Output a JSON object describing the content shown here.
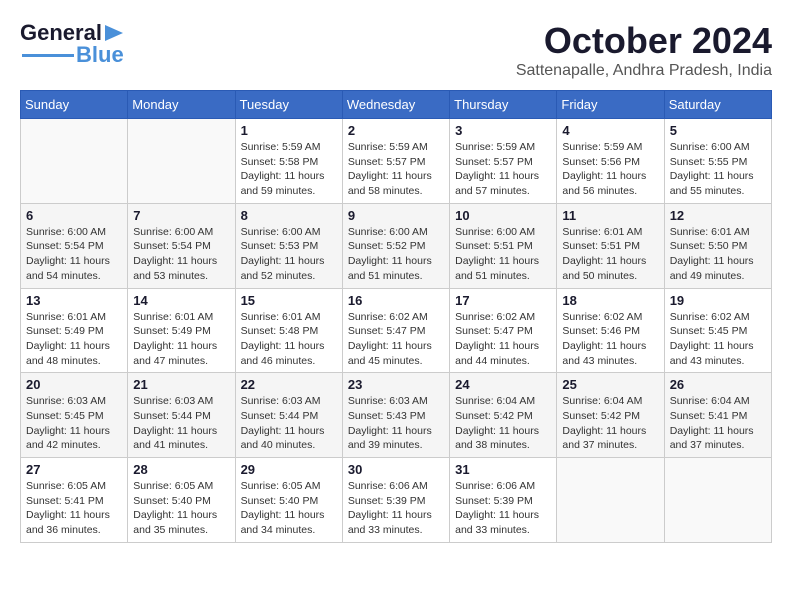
{
  "header": {
    "logo_general": "General",
    "logo_blue": "Blue",
    "month_title": "October 2024",
    "location": "Sattenapalle, Andhra Pradesh, India"
  },
  "calendar": {
    "headers": [
      "Sunday",
      "Monday",
      "Tuesday",
      "Wednesday",
      "Thursday",
      "Friday",
      "Saturday"
    ],
    "weeks": [
      [
        {
          "day": "",
          "info": ""
        },
        {
          "day": "",
          "info": ""
        },
        {
          "day": "1",
          "info": "Sunrise: 5:59 AM\nSunset: 5:58 PM\nDaylight: 11 hours and 59 minutes."
        },
        {
          "day": "2",
          "info": "Sunrise: 5:59 AM\nSunset: 5:57 PM\nDaylight: 11 hours and 58 minutes."
        },
        {
          "day": "3",
          "info": "Sunrise: 5:59 AM\nSunset: 5:57 PM\nDaylight: 11 hours and 57 minutes."
        },
        {
          "day": "4",
          "info": "Sunrise: 5:59 AM\nSunset: 5:56 PM\nDaylight: 11 hours and 56 minutes."
        },
        {
          "day": "5",
          "info": "Sunrise: 6:00 AM\nSunset: 5:55 PM\nDaylight: 11 hours and 55 minutes."
        }
      ],
      [
        {
          "day": "6",
          "info": "Sunrise: 6:00 AM\nSunset: 5:54 PM\nDaylight: 11 hours and 54 minutes."
        },
        {
          "day": "7",
          "info": "Sunrise: 6:00 AM\nSunset: 5:54 PM\nDaylight: 11 hours and 53 minutes."
        },
        {
          "day": "8",
          "info": "Sunrise: 6:00 AM\nSunset: 5:53 PM\nDaylight: 11 hours and 52 minutes."
        },
        {
          "day": "9",
          "info": "Sunrise: 6:00 AM\nSunset: 5:52 PM\nDaylight: 11 hours and 51 minutes."
        },
        {
          "day": "10",
          "info": "Sunrise: 6:00 AM\nSunset: 5:51 PM\nDaylight: 11 hours and 51 minutes."
        },
        {
          "day": "11",
          "info": "Sunrise: 6:01 AM\nSunset: 5:51 PM\nDaylight: 11 hours and 50 minutes."
        },
        {
          "day": "12",
          "info": "Sunrise: 6:01 AM\nSunset: 5:50 PM\nDaylight: 11 hours and 49 minutes."
        }
      ],
      [
        {
          "day": "13",
          "info": "Sunrise: 6:01 AM\nSunset: 5:49 PM\nDaylight: 11 hours and 48 minutes."
        },
        {
          "day": "14",
          "info": "Sunrise: 6:01 AM\nSunset: 5:49 PM\nDaylight: 11 hours and 47 minutes."
        },
        {
          "day": "15",
          "info": "Sunrise: 6:01 AM\nSunset: 5:48 PM\nDaylight: 11 hours and 46 minutes."
        },
        {
          "day": "16",
          "info": "Sunrise: 6:02 AM\nSunset: 5:47 PM\nDaylight: 11 hours and 45 minutes."
        },
        {
          "day": "17",
          "info": "Sunrise: 6:02 AM\nSunset: 5:47 PM\nDaylight: 11 hours and 44 minutes."
        },
        {
          "day": "18",
          "info": "Sunrise: 6:02 AM\nSunset: 5:46 PM\nDaylight: 11 hours and 43 minutes."
        },
        {
          "day": "19",
          "info": "Sunrise: 6:02 AM\nSunset: 5:45 PM\nDaylight: 11 hours and 43 minutes."
        }
      ],
      [
        {
          "day": "20",
          "info": "Sunrise: 6:03 AM\nSunset: 5:45 PM\nDaylight: 11 hours and 42 minutes."
        },
        {
          "day": "21",
          "info": "Sunrise: 6:03 AM\nSunset: 5:44 PM\nDaylight: 11 hours and 41 minutes."
        },
        {
          "day": "22",
          "info": "Sunrise: 6:03 AM\nSunset: 5:44 PM\nDaylight: 11 hours and 40 minutes."
        },
        {
          "day": "23",
          "info": "Sunrise: 6:03 AM\nSunset: 5:43 PM\nDaylight: 11 hours and 39 minutes."
        },
        {
          "day": "24",
          "info": "Sunrise: 6:04 AM\nSunset: 5:42 PM\nDaylight: 11 hours and 38 minutes."
        },
        {
          "day": "25",
          "info": "Sunrise: 6:04 AM\nSunset: 5:42 PM\nDaylight: 11 hours and 37 minutes."
        },
        {
          "day": "26",
          "info": "Sunrise: 6:04 AM\nSunset: 5:41 PM\nDaylight: 11 hours and 37 minutes."
        }
      ],
      [
        {
          "day": "27",
          "info": "Sunrise: 6:05 AM\nSunset: 5:41 PM\nDaylight: 11 hours and 36 minutes."
        },
        {
          "day": "28",
          "info": "Sunrise: 6:05 AM\nSunset: 5:40 PM\nDaylight: 11 hours and 35 minutes."
        },
        {
          "day": "29",
          "info": "Sunrise: 6:05 AM\nSunset: 5:40 PM\nDaylight: 11 hours and 34 minutes."
        },
        {
          "day": "30",
          "info": "Sunrise: 6:06 AM\nSunset: 5:39 PM\nDaylight: 11 hours and 33 minutes."
        },
        {
          "day": "31",
          "info": "Sunrise: 6:06 AM\nSunset: 5:39 PM\nDaylight: 11 hours and 33 minutes."
        },
        {
          "day": "",
          "info": ""
        },
        {
          "day": "",
          "info": ""
        }
      ]
    ]
  }
}
